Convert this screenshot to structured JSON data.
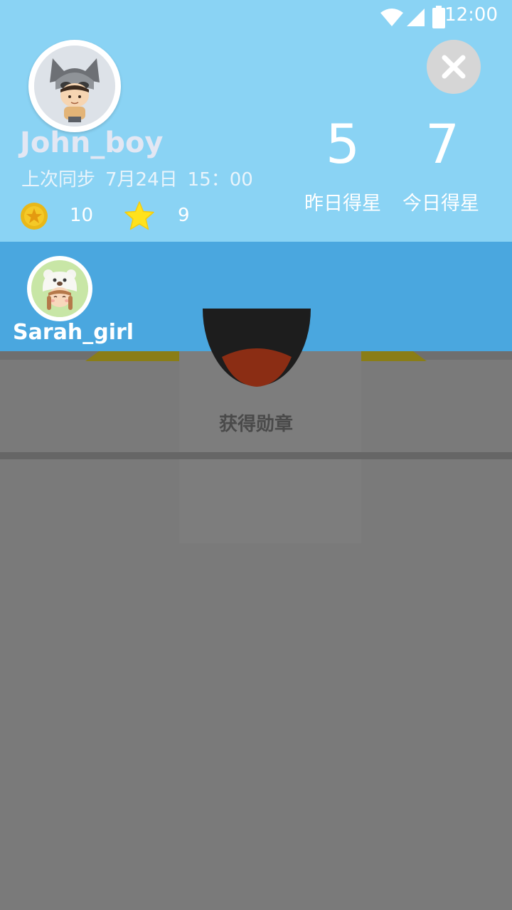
{
  "status_bar": {
    "time": "12:00",
    "icons": [
      "wifi-icon",
      "signal-icon",
      "battery-icon"
    ]
  },
  "profile": {
    "username": "John_boy",
    "sync_label": "上次同步",
    "sync_date": "7月24日",
    "sync_time": "15：00",
    "coins": "10",
    "stars": "9"
  },
  "stats": {
    "yesterday_value": "5",
    "yesterday_label": "昨日得星",
    "today_value": "7",
    "today_label": "今日得星"
  },
  "friends": [
    {
      "name": "Sarah_girl"
    }
  ],
  "overlay": {
    "badge_title": "获得勋章"
  },
  "colors": {
    "header_bg": "#8ad3f4",
    "friend_strip_bg": "#4aa7df",
    "dim_overlay": "#7a7a7a",
    "coin": "#e9b818",
    "star": "#ffe21c"
  }
}
